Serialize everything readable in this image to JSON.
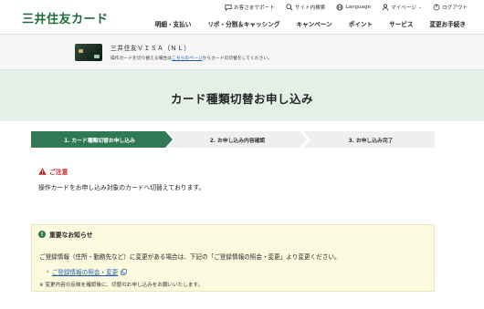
{
  "header": {
    "logo_text": "三井住友カード",
    "utility": [
      {
        "label": "お客さまサポート",
        "icon": "chat-bubble-icon"
      },
      {
        "label": "サイト内検索",
        "icon": "search-icon"
      },
      {
        "label": "Language",
        "icon": "globe-icon"
      },
      {
        "label": "マイページ",
        "icon": "person-icon"
      },
      {
        "label": "ログアウト",
        "icon": "logout-icon"
      }
    ],
    "nav": [
      "明細・支払い",
      "リボ・分割＆キャッシング",
      "キャンペーン",
      "ポイント",
      "サービス",
      "変更お手続き"
    ]
  },
  "card": {
    "name": "三井住友ＶＩＳＡ（ＮＬ）",
    "note_prefix": "操作カードを切り替える場合は",
    "note_link": "こちらのページ",
    "note_suffix": "からカードの切替をしてください。"
  },
  "page_title": "カード種類切替お申し込み",
  "steps": [
    {
      "label": "1. カード種類切替お申し込み",
      "active": true
    },
    {
      "label": "2. お申し込み内容確認",
      "active": false
    },
    {
      "label": "3. お申し込み完了",
      "active": false
    }
  ],
  "notice": {
    "heading": "ご注意",
    "body": "操作カードをお申し込み対象のカードへ切替えております。"
  },
  "important": {
    "heading": "重要なお知らせ",
    "body": "ご登録情報（住所・勤務先など）に変更がある場合は、下記の「ご登録情報の照会・変更」より変更ください。",
    "link_label": "ご登録情報の照会・変更",
    "note": "※ 変更内容の反映を確認後に、切替のお申し込みをお願いいたします。"
  },
  "colors": {
    "brand_green": "#1c6b3a",
    "step_active": "#2f7a55",
    "step_inactive": "#efefef",
    "title_band": "#e4efe8",
    "alert_red": "#c4231d",
    "important_bg": "#fbf9de"
  }
}
